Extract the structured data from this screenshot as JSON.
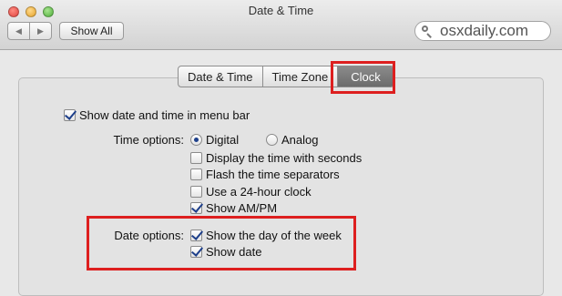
{
  "window": {
    "title": "Date & Time"
  },
  "toolbar": {
    "back_icon": "◀",
    "forward_icon": "▶",
    "show_all_label": "Show All"
  },
  "search": {
    "value": "osxdaily.com"
  },
  "tabs": [
    {
      "label": "Date & Time",
      "selected": false
    },
    {
      "label": "Time Zone",
      "selected": false
    },
    {
      "label": "Clock",
      "selected": true
    }
  ],
  "clock": {
    "show_in_menu_bar": {
      "label": "Show date and time in menu bar",
      "checked": true
    },
    "time_options": {
      "label": "Time options:",
      "digital_label": "Digital",
      "analog_label": "Analog",
      "selected": "Digital",
      "show_seconds": {
        "label": "Display the time with seconds",
        "checked": false
      },
      "flash_separators": {
        "label": "Flash the time separators",
        "checked": false
      },
      "use_24_hour": {
        "label": "Use a 24-hour clock",
        "checked": false
      },
      "show_am_pm": {
        "label": "Show AM/PM",
        "checked": true
      }
    },
    "date_options": {
      "label": "Date options:",
      "show_day_of_week": {
        "label": "Show the day of the week",
        "checked": true
      },
      "show_date": {
        "label": "Show date",
        "checked": true
      }
    }
  },
  "colors": {
    "highlight": "#dd1f1f",
    "active_tab": "#7a7a7a",
    "check": "#1d3f8a"
  }
}
